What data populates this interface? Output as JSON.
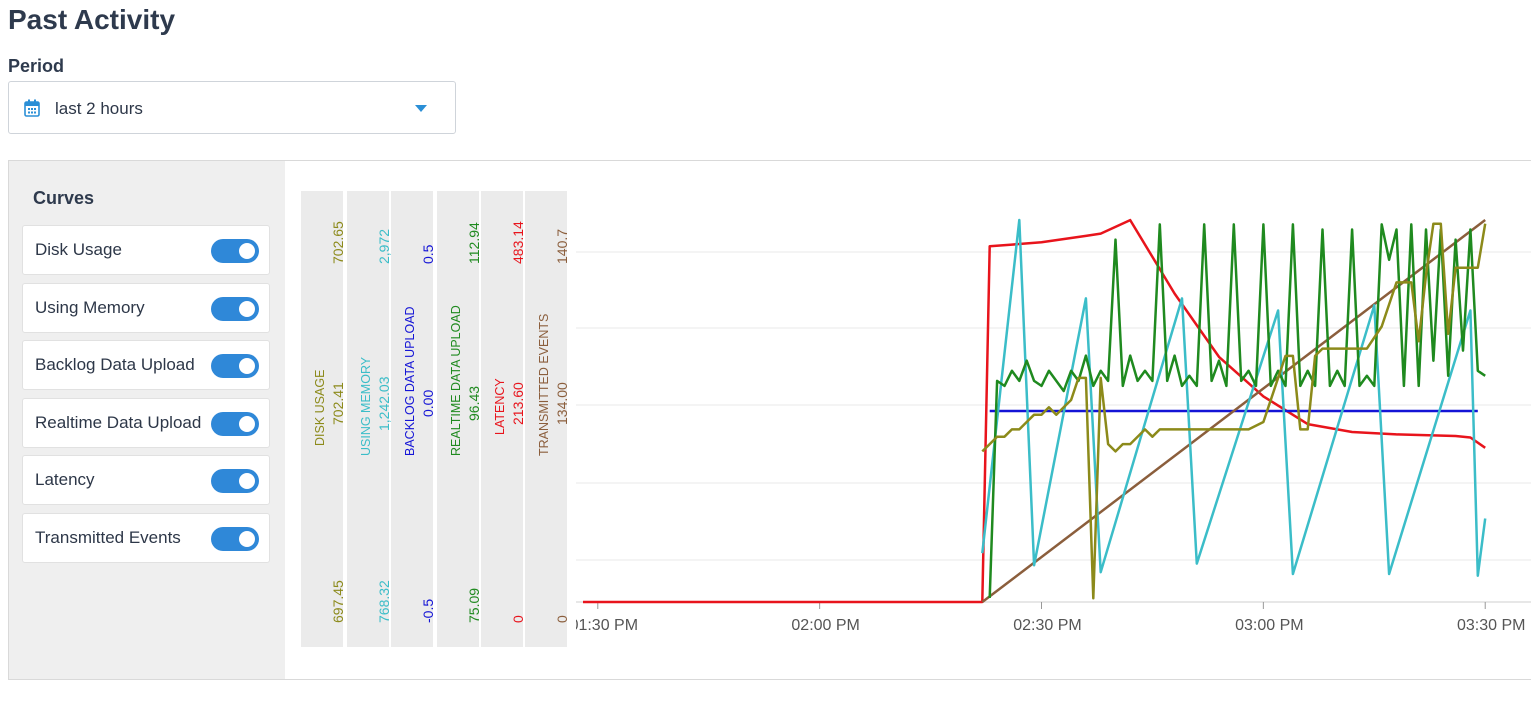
{
  "page": {
    "title": "Past Activity"
  },
  "period": {
    "label": "Period",
    "value": "last 2 hours",
    "icon": "calendar-icon"
  },
  "curves": {
    "title": "Curves",
    "items": [
      {
        "label": "Disk Usage",
        "enabled": true
      },
      {
        "label": "Using Memory",
        "enabled": true
      },
      {
        "label": "Backlog Data Upload",
        "enabled": true
      },
      {
        "label": "Realtime Data Upload",
        "enabled": true
      },
      {
        "label": "Latency",
        "enabled": true
      },
      {
        "label": "Transmitted Events",
        "enabled": true
      }
    ]
  },
  "axes": [
    {
      "name": "DISK USAGE",
      "max": "702.65",
      "mid": "702.41",
      "min": "697.45",
      "color": "#8c8a1a"
    },
    {
      "name": "USING MEMORY",
      "max": "2,972",
      "mid": "1,242.03",
      "min": "768.32",
      "color": "#3bbdc8"
    },
    {
      "name": "BACKLOG DATA UPLOAD",
      "max": "0.5",
      "mid": "0.00",
      "min": "-0.5",
      "color": "#1414d6"
    },
    {
      "name": "REALTIME DATA UPLOAD",
      "max": "112.94",
      "mid": "96.43",
      "min": "75.09",
      "color": "#1f8a1f"
    },
    {
      "name": "LATENCY",
      "max": "483.14",
      "mid": "213.60",
      "min": "0",
      "color": "#e8141c"
    },
    {
      "name": "TRANSMITTED EVENTS",
      "max": "140.7",
      "mid": "134.00",
      "min": "0",
      "color": "#8b5e3c"
    }
  ],
  "chart_data": {
    "type": "line",
    "x_ticks": [
      "01:30 PM",
      "02:00 PM",
      "02:30 PM",
      "03:00 PM",
      "03:30 PM"
    ],
    "x_range_minutes": [
      -2,
      122
    ],
    "grid": true,
    "series": [
      {
        "name": "Latency",
        "color": "#e8141c",
        "axis_range": [
          0,
          483.14
        ],
        "points": [
          [
            -2,
            0
          ],
          [
            52,
            0
          ],
          [
            53,
            450
          ],
          [
            56,
            452
          ],
          [
            60,
            455
          ],
          [
            66,
            463
          ],
          [
            68,
            466
          ],
          [
            72,
            483
          ],
          [
            78,
            390
          ],
          [
            84,
            310
          ],
          [
            90,
            260
          ],
          [
            96,
            225
          ],
          [
            102,
            215
          ],
          [
            108,
            212
          ],
          [
            116,
            210
          ],
          [
            118,
            208
          ],
          [
            120,
            195
          ]
        ]
      },
      {
        "name": "Backlog Data Upload",
        "color": "#1414d6",
        "axis_range": [
          -0.5,
          0.5
        ],
        "points": [
          [
            53,
            0
          ],
          [
            119,
            0
          ]
        ]
      },
      {
        "name": "Transmitted Events",
        "color": "#8b5e3c",
        "axis_range": [
          0,
          140.7
        ],
        "points": [
          [
            52,
            0
          ],
          [
            120,
            140.7
          ]
        ]
      },
      {
        "name": "Using Memory",
        "color": "#3bbdc8",
        "axis_range": [
          768.32,
          2972
        ],
        "points": [
          [
            52,
            1050
          ],
          [
            57,
            2972
          ],
          [
            59,
            980
          ],
          [
            66,
            2520
          ],
          [
            68,
            940
          ],
          [
            79,
            2520
          ],
          [
            81,
            990
          ],
          [
            92,
            2450
          ],
          [
            94,
            930
          ],
          [
            105,
            2480
          ],
          [
            107,
            930
          ],
          [
            118,
            2450
          ],
          [
            119,
            920
          ],
          [
            120,
            1250
          ]
        ]
      },
      {
        "name": "Realtime Data Upload",
        "color": "#1f8a1f",
        "axis_range": [
          75.09,
          112.94
        ],
        "points": [
          [
            53,
            75.5
          ],
          [
            54,
            97
          ],
          [
            55,
            96.5
          ],
          [
            56,
            98
          ],
          [
            57,
            97
          ],
          [
            58,
            99
          ],
          [
            59,
            97
          ],
          [
            60,
            96.5
          ],
          [
            61,
            98
          ],
          [
            62,
            97
          ],
          [
            63,
            96
          ],
          [
            64,
            98
          ],
          [
            65,
            97
          ],
          [
            66,
            99.5
          ],
          [
            67,
            96.5
          ],
          [
            68,
            98
          ],
          [
            69,
            97
          ],
          [
            70,
            111
          ],
          [
            71,
            96.5
          ],
          [
            72,
            99.5
          ],
          [
            73,
            97
          ],
          [
            74,
            98
          ],
          [
            75,
            97
          ],
          [
            76,
            112.5
          ],
          [
            77,
            97
          ],
          [
            78,
            99.5
          ],
          [
            79,
            96.5
          ],
          [
            80,
            97.5
          ],
          [
            81,
            96.5
          ],
          [
            82,
            112.5
          ],
          [
            83,
            97
          ],
          [
            84,
            99
          ],
          [
            85,
            96.5
          ],
          [
            86,
            112.5
          ],
          [
            87,
            97
          ],
          [
            88,
            98
          ],
          [
            89,
            96.5
          ],
          [
            90,
            112.5
          ],
          [
            91,
            96.5
          ],
          [
            92,
            98
          ],
          [
            93,
            96.5
          ],
          [
            94,
            112.5
          ],
          [
            95,
            96.5
          ],
          [
            96,
            98
          ],
          [
            97,
            96.5
          ],
          [
            98,
            112
          ],
          [
            99,
            96.5
          ],
          [
            100,
            98
          ],
          [
            101,
            96.5
          ],
          [
            102,
            112
          ],
          [
            103,
            96.5
          ],
          [
            104,
            97.5
          ],
          [
            105,
            96.5
          ],
          [
            106,
            112.5
          ],
          [
            107,
            109
          ],
          [
            108,
            112
          ],
          [
            109,
            96.5
          ],
          [
            110,
            112.5
          ],
          [
            111,
            96.5
          ],
          [
            112,
            112
          ],
          [
            113,
            99
          ],
          [
            114,
            112
          ],
          [
            115,
            97.5
          ],
          [
            116,
            111
          ],
          [
            117,
            100
          ],
          [
            118,
            112
          ],
          [
            119,
            98
          ],
          [
            120,
            97.5
          ]
        ]
      },
      {
        "name": "Disk Usage",
        "color": "#8c8a1a",
        "axis_range": [
          697.45,
          702.65
        ],
        "points": [
          [
            52,
            699.5
          ],
          [
            53,
            699.6
          ],
          [
            54,
            699.7
          ],
          [
            55,
            699.7
          ],
          [
            56,
            699.8
          ],
          [
            57,
            699.8
          ],
          [
            58,
            699.9
          ],
          [
            59,
            700.0
          ],
          [
            60,
            700.0
          ],
          [
            61,
            700.1
          ],
          [
            62,
            700.0
          ],
          [
            63,
            700.1
          ],
          [
            64,
            700.2
          ],
          [
            65,
            700.5
          ],
          [
            66,
            700.5
          ],
          [
            67,
            697.5
          ],
          [
            68,
            700.5
          ],
          [
            69,
            699.6
          ],
          [
            70,
            699.5
          ],
          [
            71,
            699.6
          ],
          [
            72,
            699.6
          ],
          [
            73,
            699.7
          ],
          [
            74,
            699.8
          ],
          [
            75,
            699.7
          ],
          [
            76,
            699.8
          ],
          [
            77,
            699.8
          ],
          [
            78,
            699.8
          ],
          [
            79,
            699.8
          ],
          [
            84,
            699.8
          ],
          [
            88,
            699.8
          ],
          [
            90,
            699.9
          ],
          [
            93,
            700.8
          ],
          [
            94,
            700.8
          ],
          [
            95,
            699.8
          ],
          [
            96,
            699.8
          ],
          [
            97,
            700.8
          ],
          [
            98,
            700.9
          ],
          [
            101,
            700.9
          ],
          [
            104,
            700.9
          ],
          [
            106,
            701.2
          ],
          [
            108,
            701.8
          ],
          [
            109,
            701.8
          ],
          [
            110,
            701.8
          ],
          [
            111,
            701.0
          ],
          [
            112,
            701.9
          ],
          [
            113,
            702.6
          ],
          [
            114,
            702.6
          ],
          [
            115,
            701.1
          ],
          [
            116,
            702.0
          ],
          [
            119,
            702.0
          ],
          [
            120,
            702.6
          ]
        ]
      }
    ]
  }
}
